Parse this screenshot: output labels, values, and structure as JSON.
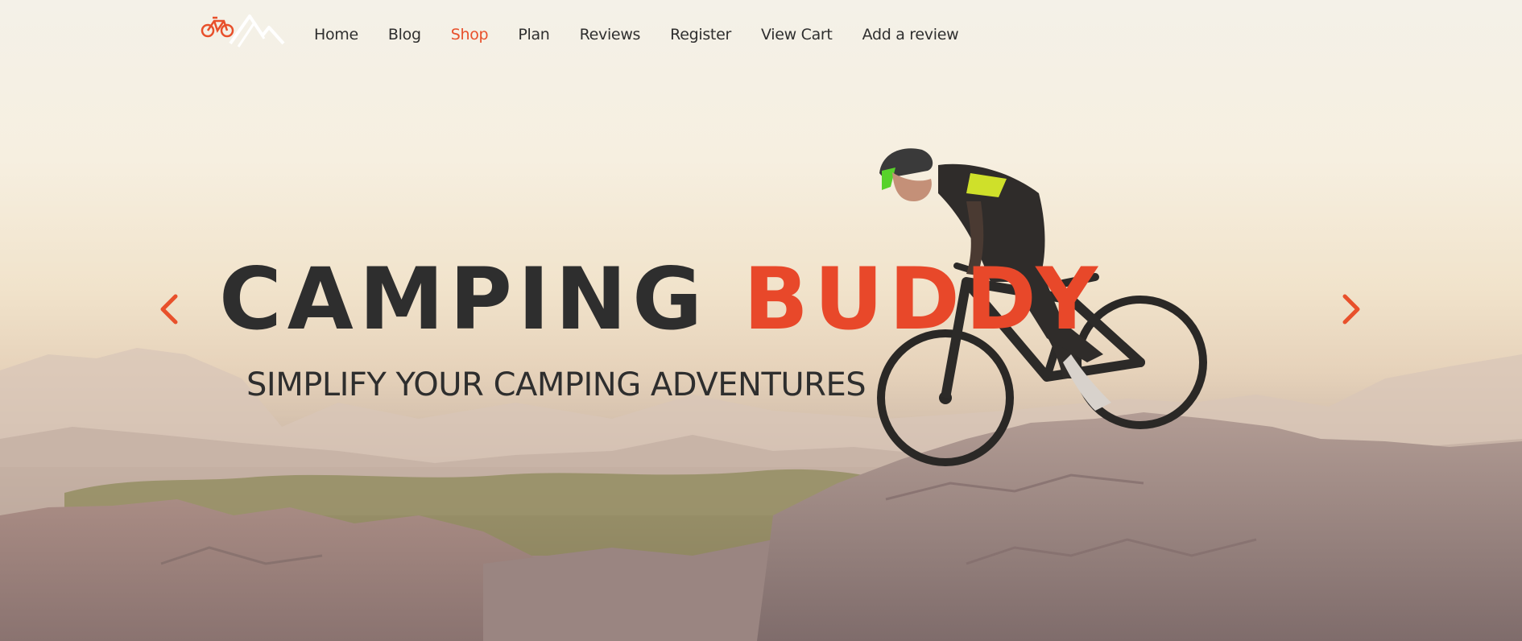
{
  "nav": {
    "logo_icon": "bike-mountain-logo-icon",
    "items": [
      {
        "label": "Home",
        "active": false
      },
      {
        "label": "Blog",
        "active": false
      },
      {
        "label": "Shop",
        "active": true
      },
      {
        "label": "Plan",
        "active": false
      },
      {
        "label": "Reviews",
        "active": false
      },
      {
        "label": "Register",
        "active": false
      },
      {
        "label": "View Cart",
        "active": false
      },
      {
        "label": "Add a review",
        "active": false
      }
    ]
  },
  "hero": {
    "title_part1": "CAMPING",
    "title_part2": "BUDDY",
    "subtitle": "SIMPLIFY YOUR CAMPING ADVENTURES",
    "prev_icon": "chevron-left-icon",
    "next_icon": "chevron-right-icon",
    "background": "mountain-biker-on-rocks-photo"
  },
  "colors": {
    "accent": "#e8502b",
    "text": "#2e2e2e"
  }
}
